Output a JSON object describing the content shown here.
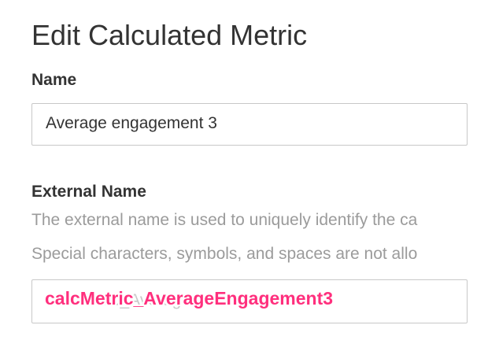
{
  "page": {
    "title": "Edit Calculated Metric"
  },
  "name_field": {
    "label": "Name",
    "value": "Average engagement 3"
  },
  "external_name_field": {
    "label": "External Name",
    "help_line_1": "The external name is used to uniquely identify the ca",
    "help_line_2": "Special characters, symbols, and spaces are not allo",
    "ghost_value": "calcMetric_Average",
    "value": "calcMetric_AverageEngagement3"
  },
  "colors": {
    "highlight": "#ff2f7d",
    "text": "#333333",
    "muted": "#9b9b9b",
    "border": "#c8c8c8"
  }
}
